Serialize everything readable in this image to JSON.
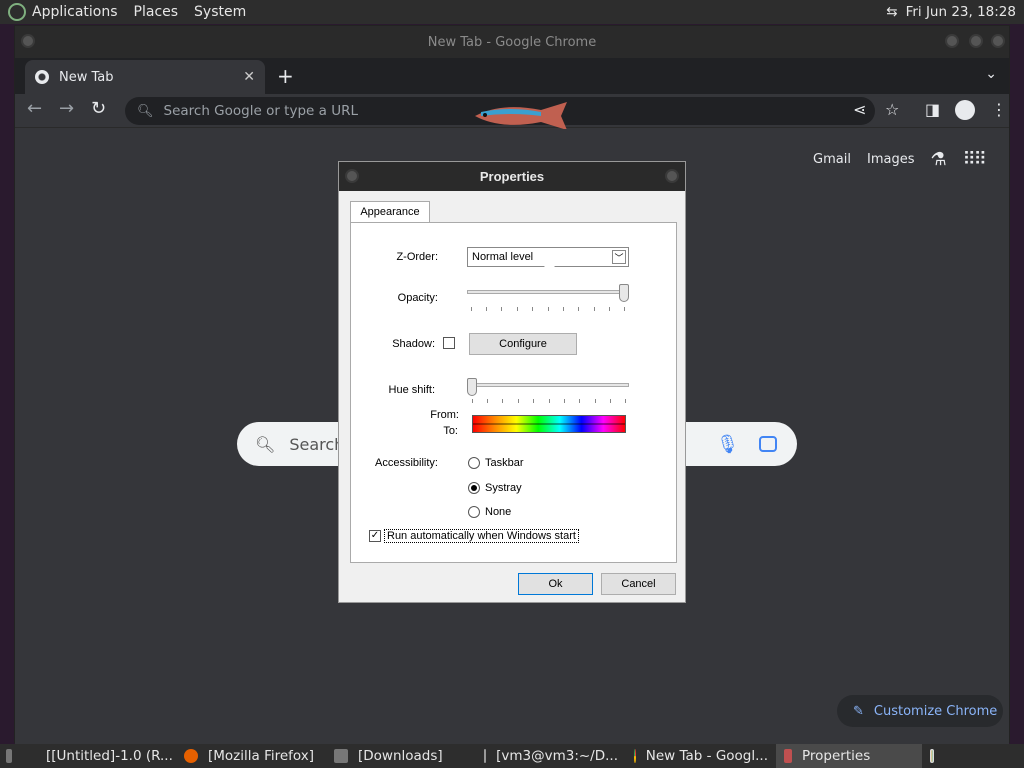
{
  "top_panel": {
    "menus": [
      "Applications",
      "Places",
      "System"
    ],
    "clock": "Fri Jun 23, 18:28",
    "net_icon": "network-icon"
  },
  "chrome": {
    "window_title": "New Tab - Google Chrome",
    "tab_title": "New Tab",
    "omnibox_placeholder": "Search Google or type a URL",
    "links": {
      "gmail": "Gmail",
      "images": "Images"
    },
    "search_placeholder": "Search",
    "customize_label": "Customize Chrome"
  },
  "dialog": {
    "title": "Properties",
    "tab": "Appearance",
    "zorder_label": "Z-Order:",
    "zorder_value": "Normal level",
    "opacity_label": "Opacity:",
    "opacity_level": 1.0,
    "shadow_label": "Shadow:",
    "configure_label": "Configure",
    "hue_label": "Hue shift:",
    "hue_level": 0.0,
    "from_label": "From:",
    "to_label": "To:",
    "accessibility_label": "Accessibility:",
    "options": {
      "taskbar": "Taskbar",
      "systray": "Systray",
      "none": "None"
    },
    "selected_option": "Systray",
    "autorun_label": "Run automatically when Windows start",
    "ok_label": "Ok",
    "cancel_label": "Cancel"
  },
  "taskbar": {
    "items": [
      "[[Untitled]-1.0 (R...",
      "[Mozilla Firefox]",
      "[Downloads]",
      "[vm3@vm3:~/D...",
      "New Tab - Googl...",
      "Properties"
    ]
  }
}
